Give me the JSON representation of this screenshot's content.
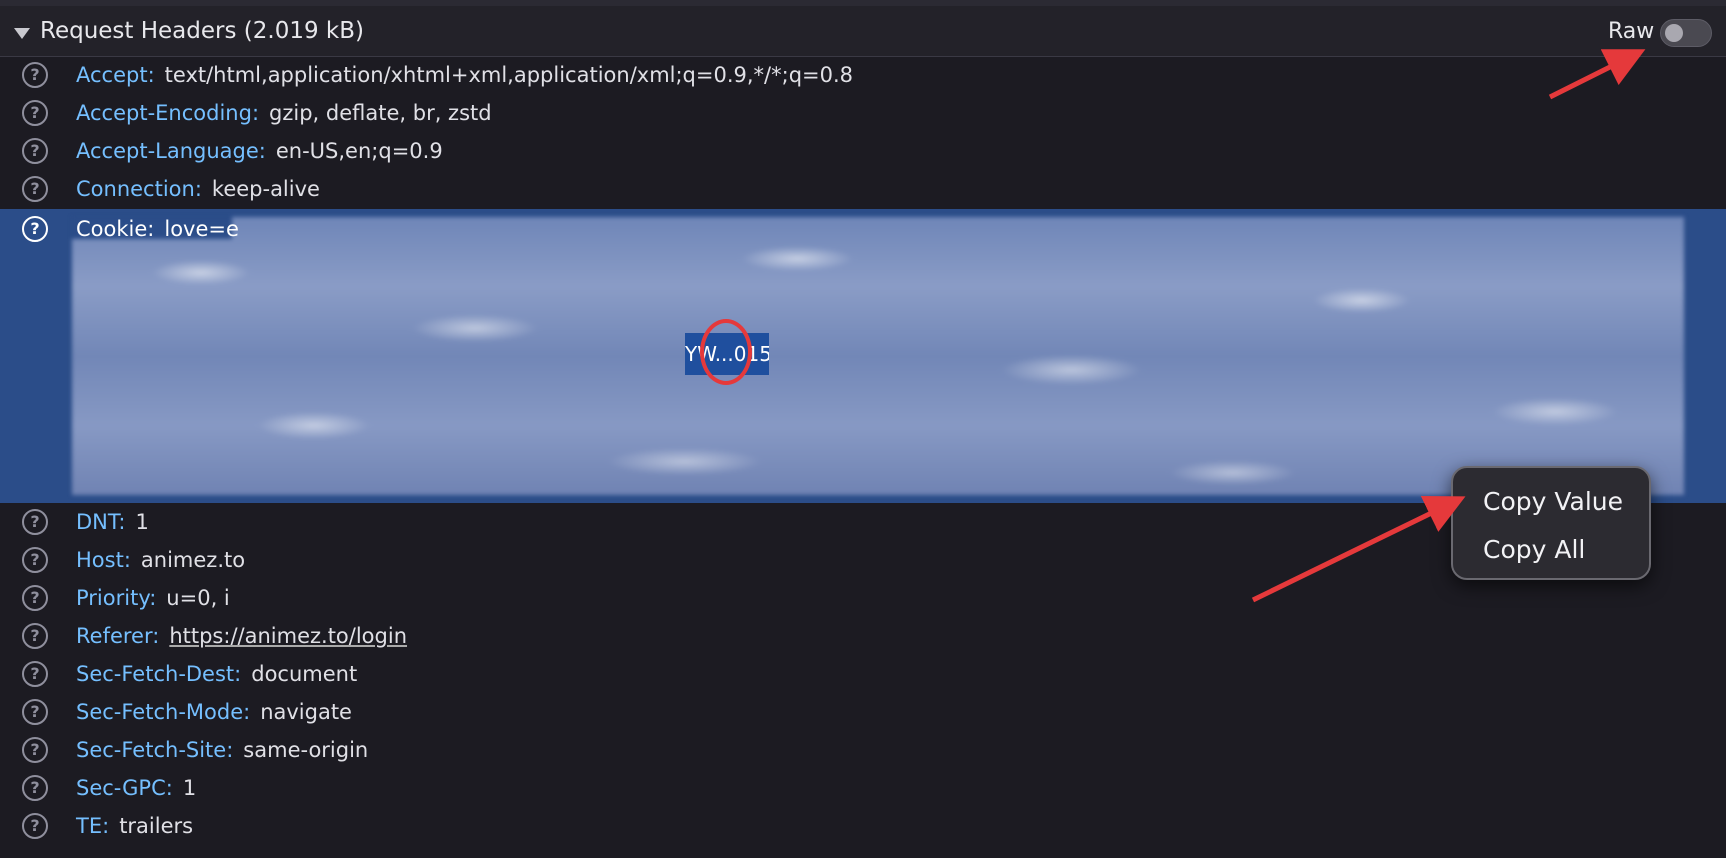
{
  "panel": {
    "title": "Request Headers (2.019 kB)",
    "raw_label": "Raw",
    "raw_enabled": false
  },
  "headers": [
    {
      "name": "Accept",
      "value": "text/html,application/xhtml+xml,application/xml;q=0.9,*/*;q=0.8"
    },
    {
      "name": "Accept-Encoding",
      "value": "gzip, deflate, br, zstd"
    },
    {
      "name": "Accept-Language",
      "value": "en-US,en;q=0.9"
    },
    {
      "name": "Connection",
      "value": "keep-alive"
    },
    {
      "name": "Cookie",
      "value": "love=e",
      "selected": true,
      "selected_snippet": "YW...015"
    },
    {
      "name": "DNT",
      "value": "1"
    },
    {
      "name": "Host",
      "value": "animez.to"
    },
    {
      "name": "Priority",
      "value": "u=0, i"
    },
    {
      "name": "Referer",
      "value": "https://animez.to/login"
    },
    {
      "name": "Sec-Fetch-Dest",
      "value": "document"
    },
    {
      "name": "Sec-Fetch-Mode",
      "value": "navigate"
    },
    {
      "name": "Sec-Fetch-Site",
      "value": "same-origin"
    },
    {
      "name": "Sec-GPC",
      "value": "1"
    },
    {
      "name": "TE",
      "value": "trailers"
    }
  ],
  "context_menu": {
    "items": [
      "Copy Value",
      "Copy All"
    ]
  },
  "help_glyph": "?",
  "separator": ":",
  "colors": {
    "background": "#1c1b22",
    "header_name": "#75bfff",
    "selection": "#2b4d89",
    "annotation": "#e5393b"
  }
}
